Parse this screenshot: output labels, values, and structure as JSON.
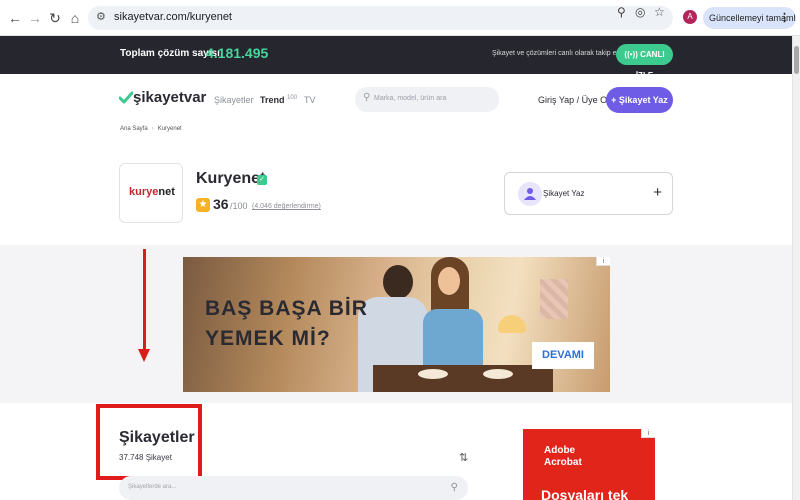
{
  "browser": {
    "url": "sikayetvar.com/kuryenet",
    "profile_initial": "A",
    "update_label": "Güncellemeyi tamamla"
  },
  "topbar": {
    "total_label": "Toplam çözüm sayısı",
    "total_count": "4.181.495",
    "follow_text": "Şikayet ve çözümleri canlı olarak takip et",
    "live_label": "CANLI İZLE"
  },
  "header": {
    "logo_text": "şikayetvar",
    "nav": {
      "complaints": "Şikayetler",
      "trend": "Trend",
      "trend_badge": "100",
      "tv": "TV"
    },
    "search_placeholder": "Marka, model, ürün ara",
    "login_label": "Giriş Yap / Üye Ol",
    "complain_button": "+ Şikayet Yaz"
  },
  "breadcrumb": {
    "home": "Ana Sayfa",
    "current": "Kuryenet"
  },
  "brand": {
    "logo_text_1": "kurye",
    "logo_text_2": "net",
    "name": "Kuryenet",
    "score": "36",
    "score_max": "/100",
    "rating_count": "(4.046 değerlendirme)"
  },
  "complain_card": {
    "label": "Şikayet Yaz",
    "plus": "+"
  },
  "ad_banner": {
    "headline_line1": "BAŞ BAŞA BİR",
    "headline_line2": "YEMEK Mİ?",
    "cta": "DEVAMI",
    "info": "i"
  },
  "complaints": {
    "title": "Şikayetler",
    "count": "37.748 Şikayet",
    "search_placeholder": "Şikayetlerde ara..."
  },
  "side_ad": {
    "brand_line1": "Adobe",
    "brand_line2": "Acrobat",
    "tagline": "Dosyaları tek",
    "info": "i"
  },
  "colors": {
    "topbar_bg": "#25262e",
    "accent_green": "#48d69c",
    "live_green": "#3dca8e",
    "brand_purple": "#6e5ce6",
    "annotation_red": "#e01b1b",
    "adobe_red": "#e2251b"
  }
}
